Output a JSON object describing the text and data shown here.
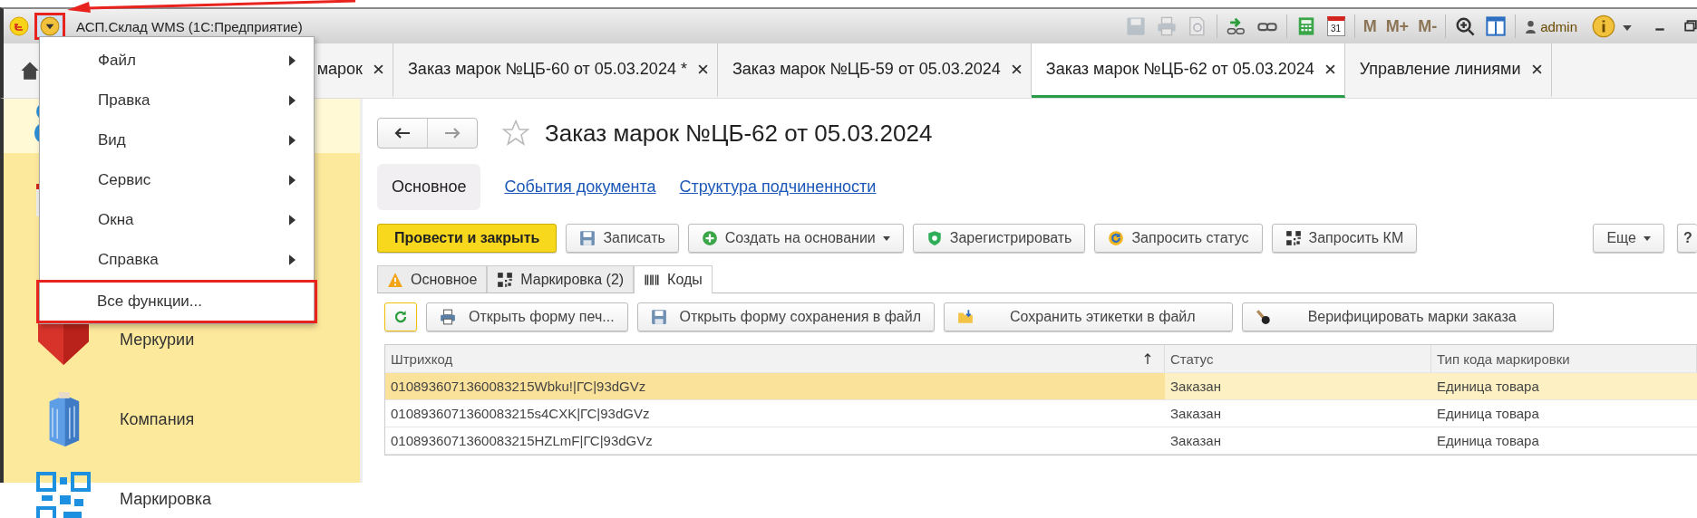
{
  "window": {
    "title": "АСП.Склад WMS  (1С:Предприятие)",
    "main_menu_button": {
      "marked": true
    },
    "memory_buttons": [
      {
        "label": "M",
        "disabled": true
      },
      {
        "label": "M+",
        "disabled": true
      },
      {
        "label": "M-",
        "disabled": true
      }
    ],
    "calendar_day": "31",
    "user": "admin"
  },
  "main_menu": {
    "items": [
      {
        "label": "Файл",
        "kind": "submenu",
        "marked": false
      },
      {
        "label": "Правка",
        "kind": "submenu",
        "marked": false
      },
      {
        "label": "Вид",
        "kind": "submenu",
        "marked": false
      },
      {
        "label": "Сервис",
        "kind": "submenu",
        "marked": false
      },
      {
        "label": "Окна",
        "kind": "submenu",
        "marked": false
      },
      {
        "label": "Справка",
        "kind": "submenu",
        "marked": false
      },
      {
        "label": "Все функции...",
        "kind": "command",
        "marked": true
      }
    ]
  },
  "tabs": [
    {
      "label": "марок",
      "selected": false
    },
    {
      "label": "Заказ марок №ЦБ-60 от 05.03.2024 *",
      "selected": false
    },
    {
      "label": "Заказ марок №ЦБ-59 от 05.03.2024",
      "selected": false
    },
    {
      "label": "Заказ марок №ЦБ-62 от 05.03.2024",
      "selected": true
    },
    {
      "label": "Управление линиями",
      "selected": false
    }
  ],
  "sidebar": {
    "items": [
      {
        "label": "Меркурии"
      },
      {
        "label": "Компания"
      },
      {
        "label": "Маркировка"
      }
    ]
  },
  "document": {
    "title": "Заказ марок №ЦБ-62 от 05.03.2024",
    "favorite": false,
    "form_tabs": [
      {
        "label": "Основное",
        "selected": true
      },
      {
        "label": "События документа",
        "selected": false
      },
      {
        "label": "Структура подчиненности",
        "selected": false
      }
    ],
    "toolbar": [
      {
        "label": "Провести и закрыть",
        "kind": "primary"
      },
      {
        "label": "Записать",
        "kind": "normal"
      },
      {
        "label": "Создать на основании",
        "kind": "dropdown"
      },
      {
        "label": "Зарегистрировать",
        "kind": "normal"
      },
      {
        "label": "Запросить статус",
        "kind": "normal"
      },
      {
        "label": "Запросить КМ",
        "kind": "normal"
      }
    ],
    "more_button": "Еще",
    "help_button": "?",
    "tabs": [
      {
        "label": "Основное",
        "selected": false
      },
      {
        "label": "Маркировка (2)",
        "selected": false
      },
      {
        "label": "Коды",
        "selected": true
      }
    ],
    "codes_toolbar": [
      "Открыть форму печ...",
      "Открыть форму сохранения в файл",
      "Сохранить этикетки в файл",
      "Верифицировать марки заказа"
    ],
    "table": {
      "columns": [
        {
          "label": "Штрихкод",
          "sorted": true
        },
        {
          "label": "Статус",
          "sorted": false
        },
        {
          "label": "Тип кода маркировки",
          "sorted": false
        }
      ],
      "rows": [
        {
          "cells": [
            "0108936071360083215Wbku!|ГС|93dGVz",
            "Заказан",
            "Единица товара"
          ],
          "selected": true
        },
        {
          "cells": [
            "0108936071360083215s4CXK|ГС|93dGVz",
            "Заказан",
            "Единица товара"
          ],
          "selected": false
        },
        {
          "cells": [
            "0108936071360083215HZLmF|ГС|93dGVz",
            "Заказан",
            "Единица товара"
          ],
          "selected": false
        }
      ]
    }
  }
}
